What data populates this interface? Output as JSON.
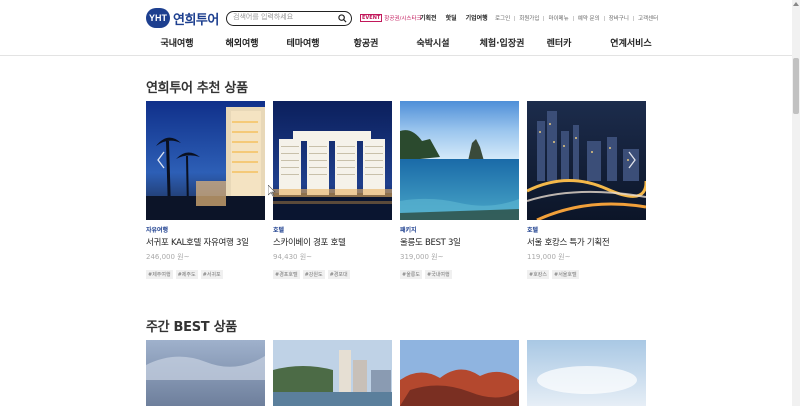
{
  "header": {
    "logo_badge": "YHT",
    "logo_text": "연희투어",
    "search_placeholder": "검색어를 입력하세요",
    "promo_badge": "EVENT",
    "promo_text": "항공권/시스타크",
    "quick_links": [
      "기획전",
      "핫딜",
      "기업여행"
    ],
    "util_links": [
      "로그인",
      "회원가입",
      "마이메뉴",
      "예약 문의",
      "장바구니",
      "고객센터"
    ]
  },
  "gnb": [
    "국내여행",
    "해외여행",
    "테마여행",
    "항공권",
    "숙박시설",
    "체험·입장권",
    "렌터카",
    "연계서비스"
  ],
  "recommend": {
    "title": "연희투어 추천 상품",
    "cards": [
      {
        "category": "자유여행",
        "name": "서귀포 KAL호텔 자유여행 3일",
        "price": "246,000 원~",
        "tags": [
          "#제주여행",
          "#제주도",
          "#서귀포"
        ]
      },
      {
        "category": "호텔",
        "name": "스카이베이 경포 호텔",
        "price": "94,430 원~",
        "tags": [
          "#경포호텔",
          "#강원도",
          "#경포대"
        ]
      },
      {
        "category": "패키지",
        "name": "울릉도 BEST 3일",
        "price": "319,000 원~",
        "tags": [
          "#울릉도",
          "#국내여행"
        ]
      },
      {
        "category": "호텔",
        "name": "서울 호캉스 특가 기획전",
        "price": "119,000 원~",
        "tags": [
          "#호캉스",
          "#서울호텔"
        ]
      }
    ]
  },
  "weekly": {
    "title": "주간 BEST 상품"
  },
  "colors": {
    "brand": "#1d3f8f",
    "promo": "#c2185b"
  }
}
